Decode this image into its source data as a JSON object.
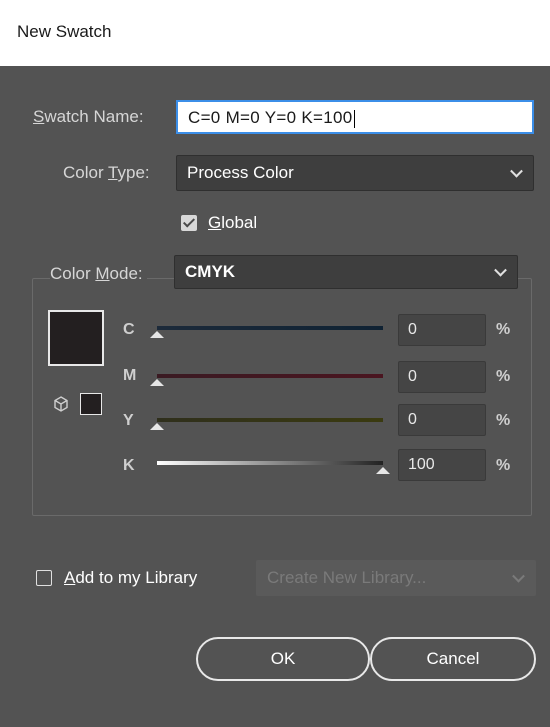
{
  "dialog": {
    "title": "New Swatch"
  },
  "swatch_name": {
    "label_underlined": "S",
    "label_rest": "watch Name:",
    "value": "C=0 M=0 Y=0 K=100"
  },
  "color_type": {
    "label_pre": "Color ",
    "label_underlined": "T",
    "label_post": "ype:",
    "value": "Process Color"
  },
  "global": {
    "label_underlined": "G",
    "label_rest": "lobal",
    "checked": true
  },
  "color_mode": {
    "label_pre": "Color ",
    "label_underlined": "M",
    "label_post": "ode:",
    "value": "CMYK"
  },
  "channels": [
    {
      "label": "C",
      "value": "0",
      "unit": "%",
      "level": 0
    },
    {
      "label": "M",
      "value": "0",
      "unit": "%",
      "level": 0
    },
    {
      "label": "Y",
      "value": "0",
      "unit": "%",
      "level": 0
    },
    {
      "label": "K",
      "value": "100",
      "unit": "%",
      "level": 1
    }
  ],
  "swatch_color": "#231f20",
  "library": {
    "label_underlined": "A",
    "label_rest": "dd to my Library",
    "checked": false,
    "dropdown_value": "Create New Library..."
  },
  "buttons": {
    "ok": "OK",
    "cancel": "Cancel"
  },
  "icons": {
    "cube": "cube-icon",
    "chevron": "chevron-down-icon",
    "check": "checkmark-icon"
  }
}
